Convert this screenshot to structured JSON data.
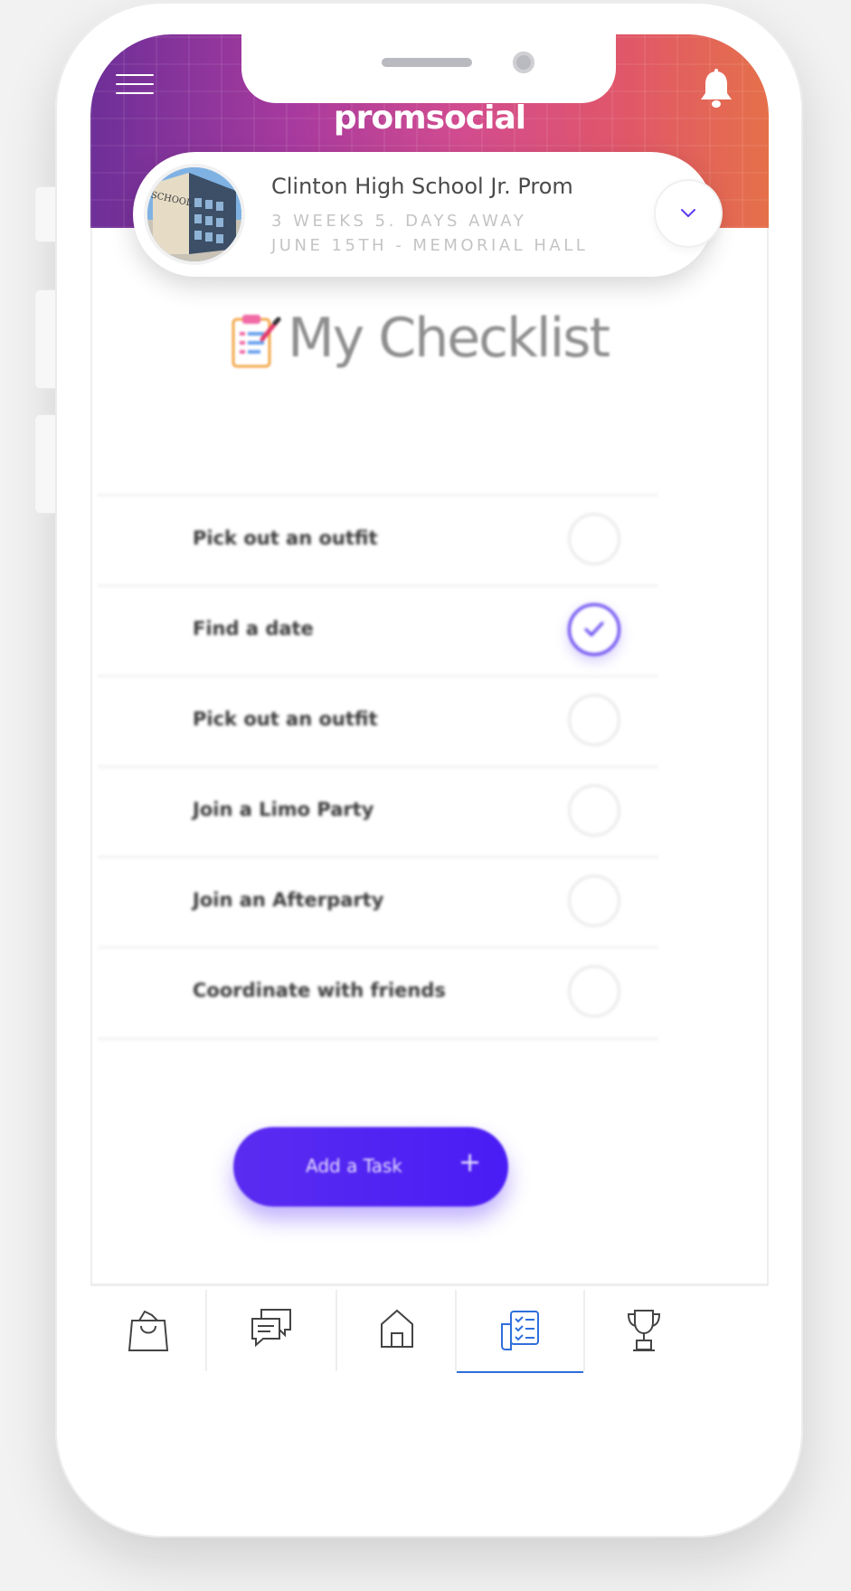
{
  "app": {
    "brand": "promsocial"
  },
  "event": {
    "title": "Clinton High School Jr. Prom",
    "countdown": "3 WEEKS  5. DAYS AWAY",
    "when_where": "JUNE 15TH -  MEMORIAL  HALL",
    "avatar_sign_text": "SCHOOL"
  },
  "checklist": {
    "title": "My Checklist",
    "tasks": [
      {
        "label": "Pick out an outfit",
        "done": false
      },
      {
        "label": "Find a date",
        "done": true
      },
      {
        "label": "Pick out an outfit",
        "done": false
      },
      {
        "label": "Join a Limo Party",
        "done": false
      },
      {
        "label": "Join an Afterparty",
        "done": false
      },
      {
        "label": "Coordinate with friends",
        "done": false
      }
    ],
    "add_button_label": "Add a Task",
    "add_button_icon": "+"
  },
  "tabbar": {
    "items": [
      {
        "icon": "shopping-bag-icon",
        "active": false
      },
      {
        "icon": "chat-icon",
        "active": false
      },
      {
        "icon": "home-icon",
        "active": false
      },
      {
        "icon": "checklist-icon",
        "active": true
      },
      {
        "icon": "trophy-icon",
        "active": false
      }
    ]
  },
  "colors": {
    "accent": "#5d3bf0",
    "button": "#4a1cf5",
    "active_tab": "#2f6fdc",
    "header_gradient_start": "#6d2f98",
    "header_gradient_end": "#e5704a"
  }
}
